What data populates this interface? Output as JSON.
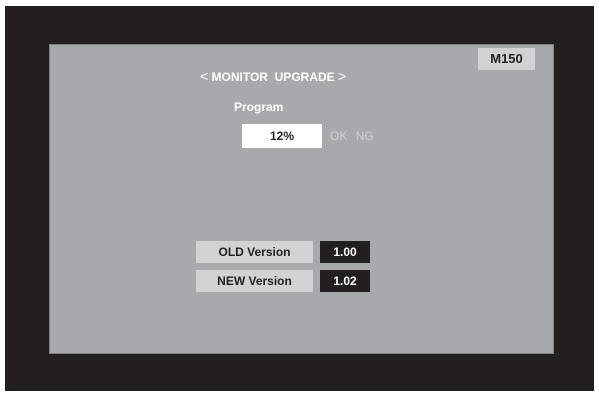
{
  "screen": {
    "model": "M150",
    "title": {
      "left_bracket": "<",
      "text": "MONITOR  UPGRADE",
      "right_bracket": ">"
    },
    "program": {
      "label": "Program",
      "progress": "12%",
      "progress_fraction": 0.12,
      "ok_label": "OK",
      "ng_label": "NG"
    },
    "versions": {
      "old": {
        "label": "OLD Version",
        "value": "1.00"
      },
      "new": {
        "label": "NEW Version",
        "value": "1.02"
      }
    }
  },
  "colors": {
    "bezel": "#231f20",
    "screen_background": "#a7a9ac",
    "badge_background": "#d1d2d4",
    "text_light": "#ffffff",
    "text_dark": "#231f20",
    "status_text": "#d1d2d4"
  }
}
